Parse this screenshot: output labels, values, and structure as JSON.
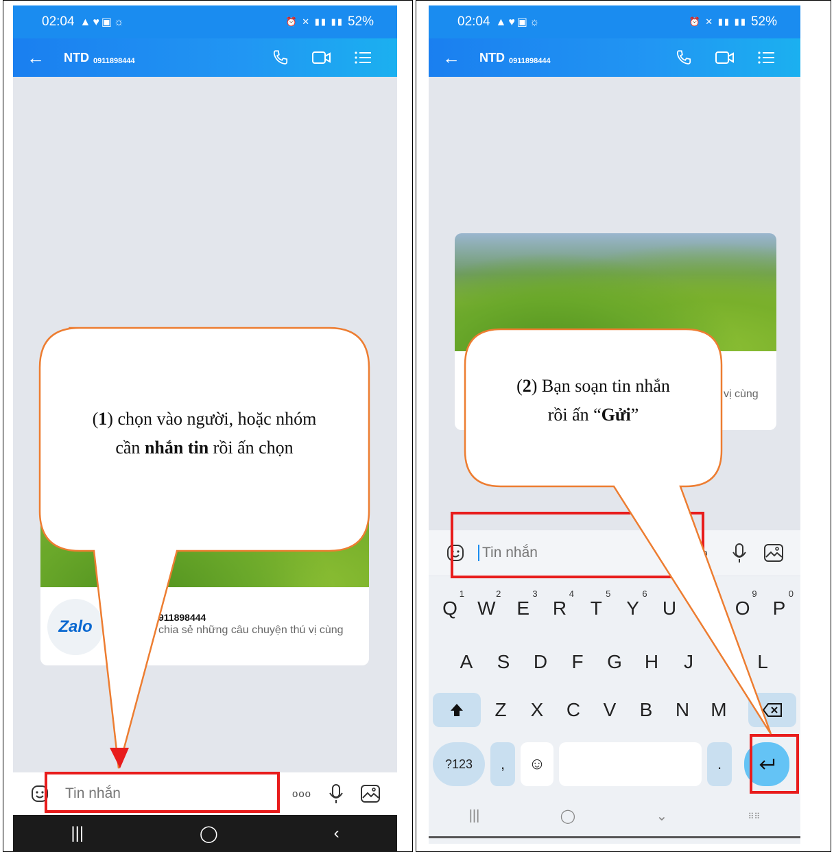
{
  "left_screen": {
    "status": {
      "time": "02:04",
      "battery": "52%"
    },
    "header": {
      "name": "NTD",
      "phone": "0911898444"
    },
    "card": {
      "phone_fragment": "911898444",
      "desc_fragment": "chia sẻ những câu chuyện thú vị cùng",
      "logo_text": "Zalo"
    },
    "input": {
      "placeholder": "Tin nhắn",
      "more": "ooo"
    },
    "callout": {
      "step": "1",
      "line1_a": ") chọn vào người, hoặc nhóm",
      "line2_a": "cần ",
      "line2_bold": "nhắn tin",
      "line2_b": " rồi ấn chọn"
    }
  },
  "right_screen": {
    "status": {
      "time": "02:04",
      "battery": "52%"
    },
    "header": {
      "name": "NTD",
      "phone": "0911898444"
    },
    "card": {
      "desc_fragment": "vị cùng"
    },
    "input": {
      "placeholder": "Tin nhắn",
      "more": "o"
    },
    "keyboard": {
      "row1": [
        {
          "k": "Q",
          "n": "1"
        },
        {
          "k": "W",
          "n": "2"
        },
        {
          "k": "E",
          "n": "3"
        },
        {
          "k": "R",
          "n": "4"
        },
        {
          "k": "T",
          "n": "5"
        },
        {
          "k": "Y",
          "n": "6"
        },
        {
          "k": "U",
          "n": ""
        },
        {
          "k": "",
          "n": "8"
        },
        {
          "k": "O",
          "n": "9"
        },
        {
          "k": "P",
          "n": "0"
        }
      ],
      "row2": [
        "A",
        "S",
        "D",
        "F",
        "G",
        "H",
        "J",
        "",
        "L"
      ],
      "row3": [
        "Z",
        "X",
        "C",
        "V",
        "B",
        "N",
        "M"
      ],
      "sym_label": "?123",
      "comma": ",",
      "period": "."
    },
    "callout": {
      "step": "2",
      "line1": ") Bạn soạn tin nhắn",
      "line2_a": "rồi ấn “",
      "line2_bold": "Gửi",
      "line2_b": "”"
    }
  },
  "colors": {
    "accent": "#1a8cf0",
    "highlight_red": "#e81c1c",
    "callout_orange": "#ed7d31",
    "enter_key": "#64c3f5"
  }
}
